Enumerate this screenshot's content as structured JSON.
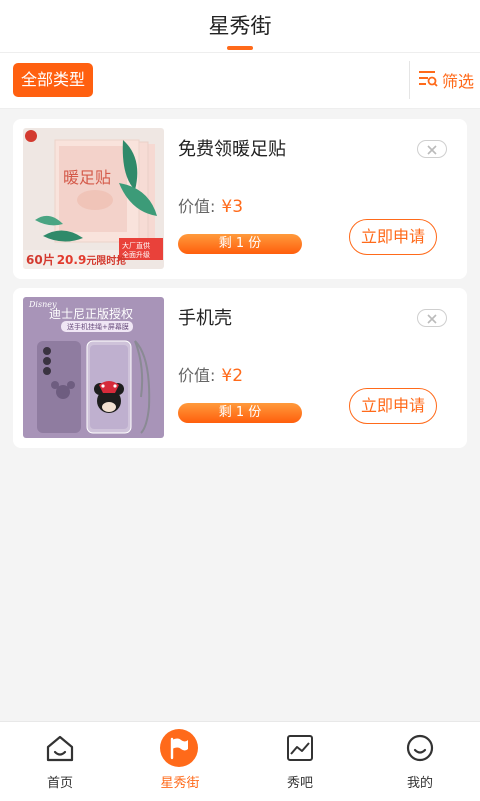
{
  "header": {
    "title": "星秀街"
  },
  "filterbar": {
    "all_types": "全部类型",
    "filter_label": "筛选"
  },
  "items": [
    {
      "name": "免费领暖足贴",
      "price_label": "价值:",
      "price": "¥3",
      "stock": "剩 1 份",
      "apply": "立即申请",
      "image": {
        "title": "暖足贴",
        "promo": "60片",
        "promo_price": "20.9",
        "promo_tail": "元限时抢",
        "badge": "大厂直供 全面升级"
      }
    },
    {
      "name": "手机壳",
      "price_label": "价值:",
      "price": "¥2",
      "stock": "剩 1 份",
      "apply": "立即申请",
      "image": {
        "brand": "Disney",
        "title": "迪士尼正版授权",
        "subtitle": "送手机挂绳+屏幕膜"
      }
    }
  ],
  "tabbar": {
    "tabs": [
      {
        "label": "首页",
        "icon": "home-icon"
      },
      {
        "label": "星秀街",
        "icon": "flag-icon",
        "active": true
      },
      {
        "label": "秀吧",
        "icon": "photo-icon"
      },
      {
        "label": "我的",
        "icon": "smile-icon"
      }
    ]
  },
  "colors": {
    "accent": "#ff6a1a",
    "background": "#f4f4f4"
  }
}
